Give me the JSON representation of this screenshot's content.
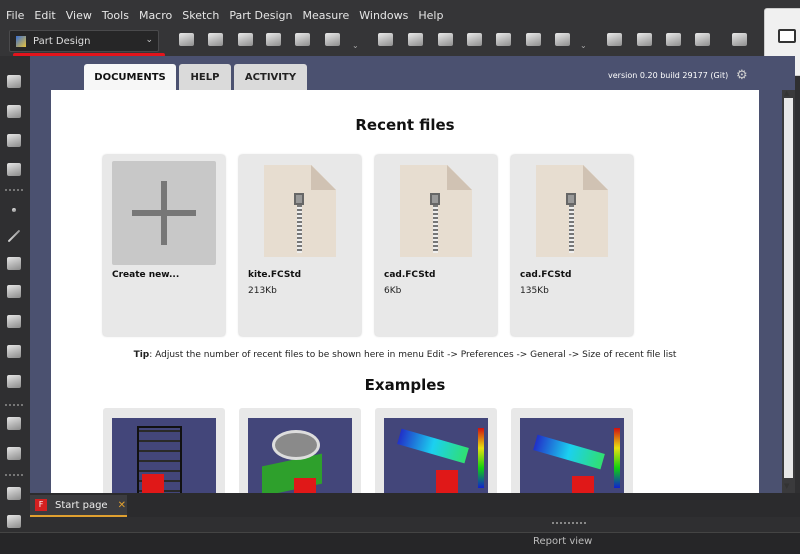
{
  "menu": [
    "File",
    "Edit",
    "View",
    "Tools",
    "Macro",
    "Sketch",
    "Part Design",
    "Measure",
    "Windows",
    "Help"
  ],
  "workbench": {
    "selected": "Part Design",
    "icon": "partdesign-icon"
  },
  "toolbar_icons": [
    "body-icon",
    "part-icon",
    "shape-binder-icon",
    "subshape-binder-icon",
    "clone-icon",
    "datum-icon",
    "sketch-icon",
    "pad-icon",
    "revolution-icon",
    "loft-icon",
    "pipe-icon",
    "helix-icon",
    "additive-primitive-icon",
    "pocket-icon",
    "hole-icon",
    "groove-icon",
    "subtractive-loft-icon",
    "subtractive-pipe-icon",
    "subtractive-helix-icon",
    "subtractive-primitive-icon"
  ],
  "tabs": {
    "documents": "DOCUMENTS",
    "help": "HELP",
    "activity": "ACTIVITY"
  },
  "version": "version 0.20 build 29177 (Git)",
  "recent": {
    "heading": "Recent files",
    "items": [
      {
        "name": "Create new...",
        "size": ""
      },
      {
        "name": "kite.FCStd",
        "size": "213Kb"
      },
      {
        "name": "cad.FCStd",
        "size": "6Kb"
      },
      {
        "name": "cad.FCStd",
        "size": "135Kb"
      }
    ]
  },
  "tip": {
    "label": "Tip",
    "text": ": Adjust the number of recent files to be shown here in menu Edit -> Preferences -> General -> Size of recent file list"
  },
  "examples": {
    "heading": "Examples"
  },
  "bottom": {
    "tab": "Start page",
    "close": "✕",
    "report": "Report view"
  }
}
